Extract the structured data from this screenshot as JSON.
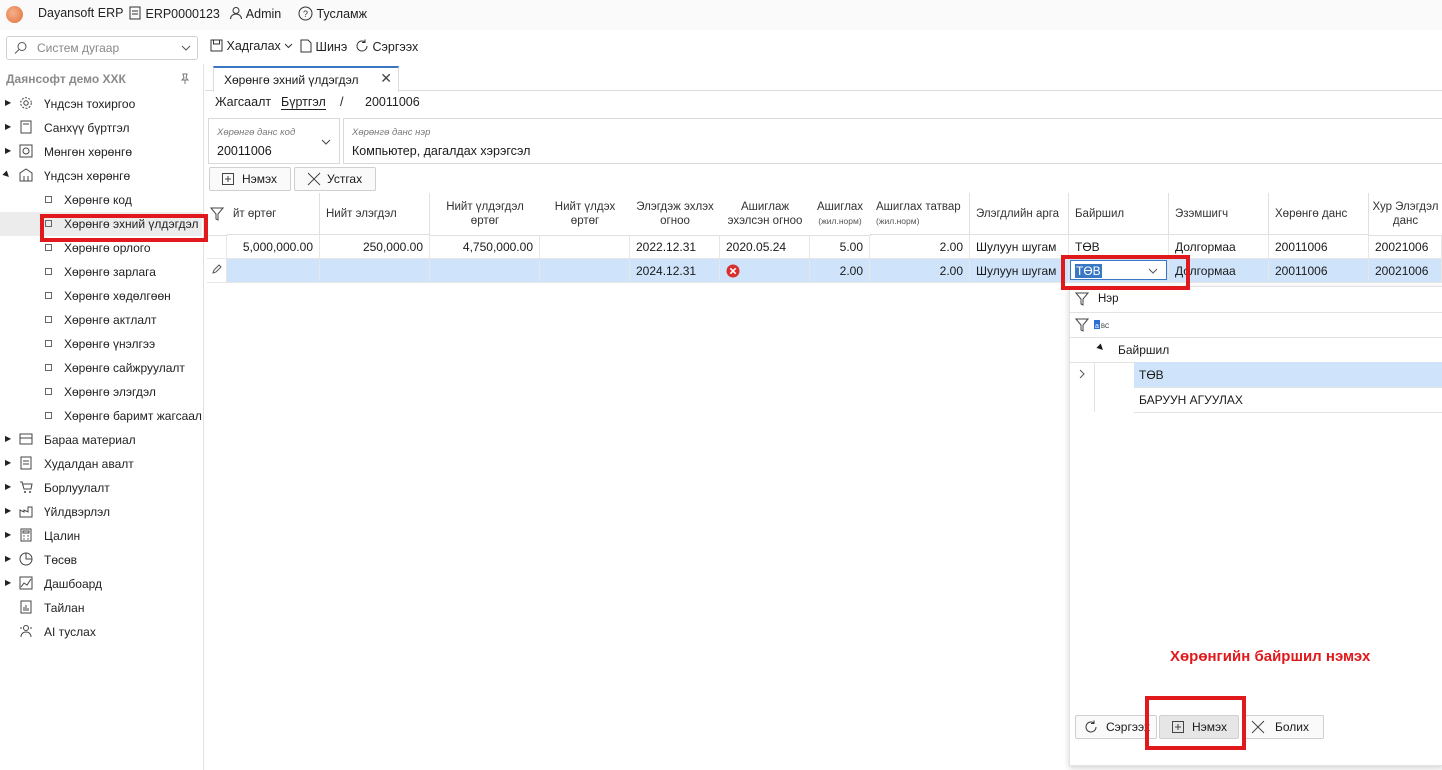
{
  "topbar": {
    "app": "Dayansoft ERP",
    "system_no": "ERP0000123",
    "user": "Admin",
    "help": "Тусламж"
  },
  "toolbar": {
    "search_placeholder": "Систем дугаар",
    "save": "Хадгалах",
    "new": "Шинэ",
    "refresh": "Сэргээх"
  },
  "sidebar": {
    "title": "Даянсофт демо ХХК",
    "items": [
      {
        "label": "Үндсэн тохиргоо",
        "icon": "gear-icon"
      },
      {
        "label": "Санхүү бүртгэл",
        "icon": "book-icon"
      },
      {
        "label": "Мөнгөн хөрөнгө",
        "icon": "safe-icon"
      },
      {
        "label": "Үндсэн хөрөнгө",
        "icon": "building-icon"
      },
      {
        "label": "Бараа материал",
        "icon": "warehouse-icon"
      },
      {
        "label": "Худалдан авалт",
        "icon": "document-icon"
      },
      {
        "label": "Борлуулалт",
        "icon": "cart-icon"
      },
      {
        "label": "Үйлдвэрлэл",
        "icon": "factory-icon"
      },
      {
        "label": "Цалин",
        "icon": "calculator-icon"
      },
      {
        "label": "Төсөв",
        "icon": "pie-chart-icon"
      },
      {
        "label": "Дашбоард",
        "icon": "dashboard-icon"
      },
      {
        "label": "Тайлан",
        "icon": "report-icon"
      },
      {
        "label": "AI туслах",
        "icon": "assistant-icon"
      }
    ],
    "children": [
      "Хөрөнгө код",
      "Хөрөнгө эхний үлдэгдэл",
      "Хөрөнгө орлого",
      "Хөрөнгө зарлага",
      "Хөрөнгө хөдөлгөөн",
      "Хөрөнгө актлалт",
      "Хөрөнгө үнэлгээ",
      "Хөрөнгө сайжруулалт",
      "Хөрөнгө элэгдэл",
      "Хөрөнгө баримт жагсаал"
    ]
  },
  "tab": {
    "label": "Хөрөнгө эхний үлдэгдэл"
  },
  "breadcrumb": {
    "list": "Жагсаалт",
    "register": "Бүртгэл",
    "sep": "/",
    "code": "20011006"
  },
  "form": {
    "code_caption": "Хөрөнгө данс код",
    "code_value": "20011006",
    "name_caption": "Хөрөнгө данс нэр",
    "name_value": "Компьютер, дагалдах хэрэгсэл"
  },
  "grid_buttons": {
    "add": "Нэмэх",
    "delete": "Устгах"
  },
  "grid": {
    "headers": [
      {
        "l1": "йт өртөг",
        "l2": ""
      },
      {
        "l1": "Нийт элэгдэл",
        "l2": ""
      },
      {
        "l1": "Нийт үлдэгдэл",
        "l2": "өртөг"
      },
      {
        "l1": "Нийт үлдэх",
        "l2": "өртөг"
      },
      {
        "l1": "Элэгдэж эхлэх",
        "l2": "огноо"
      },
      {
        "l1": "Ашиглаж",
        "l2": "эхэлсэн огноо"
      },
      {
        "l1": "Ашиглах",
        "l2": "(жил.норм)"
      },
      {
        "l1": "Ашиглах татвар",
        "l2": "(жил.норм)"
      },
      {
        "l1": "Элэгдлийн арга",
        "l2": ""
      },
      {
        "l1": "Байршил",
        "l2": ""
      },
      {
        "l1": "Эзэмшигч",
        "l2": ""
      },
      {
        "l1": "Хөрөнгө данс",
        "l2": ""
      },
      {
        "l1": "Хур Элэгдэл",
        "l2": "данс"
      }
    ],
    "rows": [
      [
        "5,000,000.00",
        "250,000.00",
        "4,750,000.00",
        "",
        "2022.12.31",
        "2020.05.24",
        "5.00",
        "2.00",
        "Шулуун шугам",
        "ТӨВ",
        "Долгормаа",
        "20011006",
        "20021006"
      ],
      [
        "",
        "",
        "",
        "",
        "2024.12.31",
        "",
        "2.00",
        "2.00",
        "Шулуун шугам",
        "ТӨВ",
        "Долгормаа",
        "20011006",
        "20021006"
      ]
    ]
  },
  "dropdown": {
    "filter_label": "Нэр",
    "group_header": "Байршил",
    "options": [
      "ТӨВ",
      "БАРУУН АГУУЛАХ"
    ],
    "buttons": {
      "refresh": "Сэргээх",
      "add": "Нэмэх",
      "cancel": "Болих"
    }
  },
  "annotation": {
    "text": "Хөрөнгийн байршил нэмэх",
    "color": "#e0191c"
  },
  "colors": {
    "accent": "#3b78c3",
    "selected_row": "#cfe4fb",
    "highlight": "#e0191c"
  }
}
